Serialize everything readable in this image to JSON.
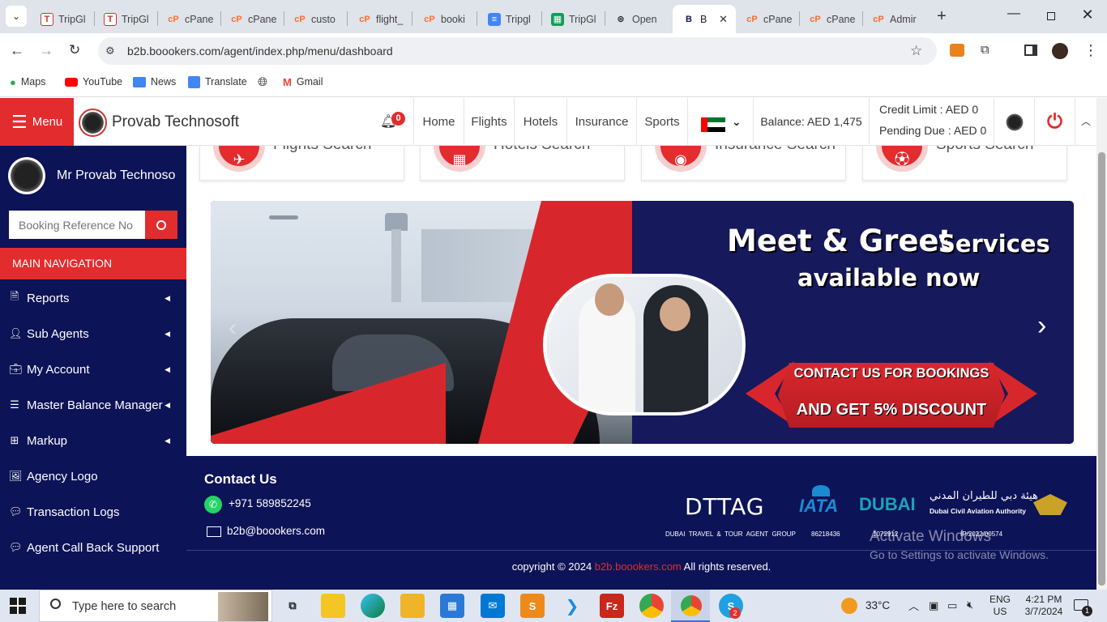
{
  "browser": {
    "tabs": [
      {
        "label": "TripGl",
        "icon": "tripgl-icon"
      },
      {
        "label": "TripGl",
        "icon": "tripgl-icon"
      },
      {
        "label": "cPane",
        "icon": "cpanel-icon"
      },
      {
        "label": "cPane",
        "icon": "cpanel-icon"
      },
      {
        "label": "custo",
        "icon": "cpanel-icon"
      },
      {
        "label": "flight_",
        "icon": "cpanel-icon"
      },
      {
        "label": "booki",
        "icon": "cpanel-icon"
      },
      {
        "label": "Tripgl",
        "icon": "docs-icon"
      },
      {
        "label": "TripGl",
        "icon": "sheets-icon"
      },
      {
        "label": "Open",
        "icon": "openai-icon"
      },
      {
        "label": "B",
        "icon": "b2b-icon"
      },
      {
        "label": "cPane",
        "icon": "cpanel-icon"
      },
      {
        "label": "cPane",
        "icon": "cpanel-icon"
      },
      {
        "label": "Admir",
        "icon": "cpanel-icon"
      }
    ],
    "url": "b2b.boookers.com/agent/index.php/menu/dashboard",
    "bookmarks": [
      "Maps",
      "YouTube",
      "News",
      "Translate",
      "",
      "Gmail"
    ]
  },
  "site": {
    "menu_label": "Menu",
    "brand": "Provab Technosoft",
    "notification_count": "0",
    "nav": [
      "Home",
      "Flights",
      "Hotels",
      "Insurance",
      "Sports"
    ],
    "balance": "Balance: AED 1,475",
    "credit_limit": "Credit Limit : AED 0",
    "pending_due": "Pending Due : AED 0"
  },
  "sidebar": {
    "user_name": "Mr Provab Technoso",
    "search_placeholder": "Booking Reference No",
    "section_title": "MAIN NAVIGATION",
    "items": [
      {
        "label": "Reports",
        "icon": "file-icon",
        "has_children": true
      },
      {
        "label": "Sub Agents",
        "icon": "user-icon",
        "has_children": true
      },
      {
        "label": "My Account",
        "icon": "briefcase-icon",
        "has_children": true
      },
      {
        "label": "Master Balance Manager",
        "icon": "list-icon",
        "has_children": true
      },
      {
        "label": "Markup",
        "icon": "plus-square-icon",
        "has_children": true
      },
      {
        "label": "Agency Logo",
        "icon": "image-icon",
        "has_children": false
      },
      {
        "label": "Transaction Logs",
        "icon": "comment-icon",
        "has_children": false
      },
      {
        "label": "Agent Call Back Support",
        "icon": "comment-icon",
        "has_children": false
      }
    ]
  },
  "services": [
    "Flights Search",
    "Hotels Search",
    "Insurance Search",
    "Sports Search"
  ],
  "banner": {
    "headline_1": "Meet & Greet",
    "headline_1b": "Services",
    "headline_2": "available now",
    "cta_1": "CONTACT US FOR BOOKINGS",
    "cta_2": "AND GET 5% DISCOUNT"
  },
  "footer": {
    "contact_title": "Contact Us",
    "phone": "+971  589852245",
    "email": "b2b@boookers.com",
    "copyright_prefix": "copyright © 2024 ",
    "copyright_link": "b2b.boookers.com",
    "copyright_suffix": " All rights reserved.",
    "logos": {
      "dttag": "DTTAG",
      "dttag_caption": "DUBAI  TRAVEL  &  TOUR  AGENT  GROUP",
      "iata": "IATA",
      "iata_code": "86218436",
      "dubai": "DUBAI",
      "dubai_code": "1072912",
      "dcaa_arabic": "هيئة دبي للطيران المدني",
      "dcaa": "Dubai Civil Aviation Authority",
      "dcaa_code": "IP/2022/00574"
    },
    "watermark_1": "Activate Windows",
    "watermark_2": "Go to Settings to activate Windows."
  },
  "taskbar": {
    "search_placeholder": "Type here to search",
    "weather": "33°C",
    "lang_1": "ENG",
    "lang_2": "US",
    "time": "4:21 PM",
    "date": "3/7/2024",
    "skype_badge": "2",
    "notif_badge": "1"
  },
  "colors": {
    "brand_red": "#e32c2e",
    "navy": "#0d1357",
    "footer_link": "#e32c2e"
  }
}
